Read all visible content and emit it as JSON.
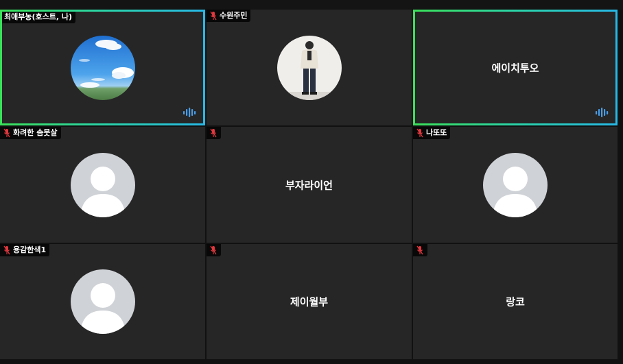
{
  "participants": [
    {
      "name": "최애부농(호스트, 나)",
      "display": "",
      "avatar": "sky-photo",
      "muted": false,
      "speaking": true
    },
    {
      "name": "수원주민",
      "display": "",
      "avatar": "person-photo",
      "muted": true,
      "speaking": false
    },
    {
      "name": "",
      "display": "에이치투오",
      "avatar": "none",
      "muted": false,
      "speaking": true
    },
    {
      "name": "화려한 솜뭇살",
      "display": "",
      "avatar": "default-silhouette",
      "muted": true,
      "speaking": false
    },
    {
      "name": "",
      "display": "부자라이언",
      "avatar": "none",
      "muted": true,
      "speaking": false
    },
    {
      "name": "나또또",
      "display": "",
      "avatar": "default-silhouette",
      "muted": true,
      "speaking": false
    },
    {
      "name": "용감한색1",
      "display": "",
      "avatar": "default-silhouette",
      "muted": true,
      "speaking": false
    },
    {
      "name": "",
      "display": "제이월부",
      "avatar": "none",
      "muted": true,
      "speaking": false
    },
    {
      "name": "",
      "display": "랑코",
      "avatar": "none",
      "muted": true,
      "speaking": false
    }
  ],
  "colors": {
    "tile_bg": "#262626",
    "active_border_start": "#3be05a",
    "active_border_end": "#27b9e6",
    "muted_mic": "#e0383e",
    "audio_indicator": "#4a9de8",
    "default_avatar_bg": "#cfd2d6"
  }
}
